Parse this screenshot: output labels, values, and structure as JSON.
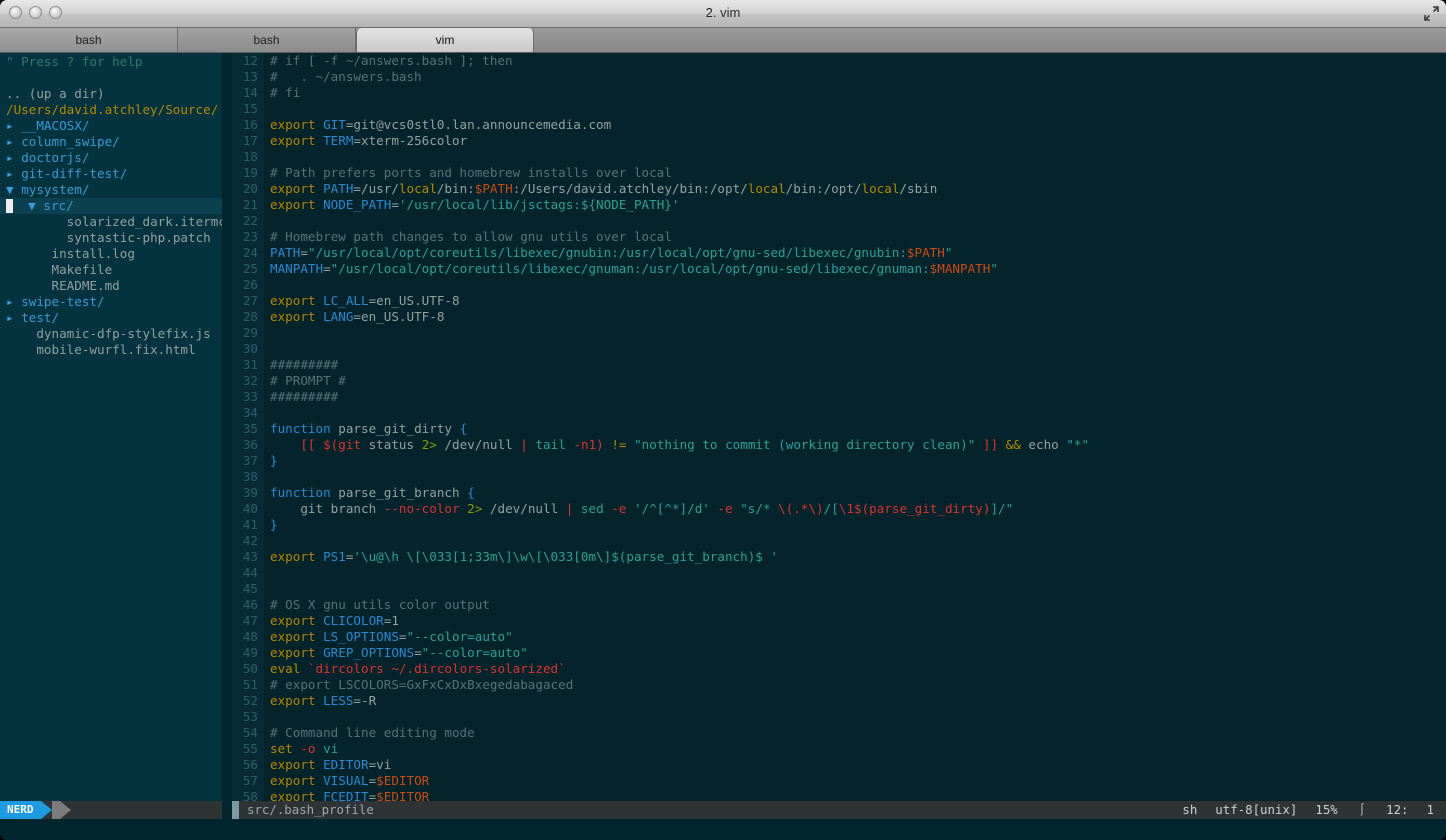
{
  "window": {
    "title": "2. vim",
    "traffic_lights": [
      "close",
      "minimize",
      "zoom"
    ],
    "fullscreen_icon": "fullscreen-icon"
  },
  "tabs": [
    {
      "label": "bash",
      "active": false
    },
    {
      "label": "bash",
      "active": false
    },
    {
      "label": "vim",
      "active": true
    }
  ],
  "nerdtree": {
    "help_line": "\" Press ? for help",
    "up_a_dir": ".. (up a dir)",
    "root": "/Users/david.atchley/Source/",
    "items": [
      {
        "label": "__MACOSX/",
        "type": "dir",
        "indent": 0,
        "open": false
      },
      {
        "label": "column_swipe/",
        "type": "dir",
        "indent": 0,
        "open": false
      },
      {
        "label": "doctorjs/",
        "type": "dir",
        "indent": 0,
        "open": false
      },
      {
        "label": "git-diff-test/",
        "type": "dir",
        "indent": 0,
        "open": false
      },
      {
        "label": "mysystem/",
        "type": "dir",
        "indent": 0,
        "open": true
      },
      {
        "label": "src/",
        "type": "dir",
        "indent": 1,
        "open": true,
        "selected": true
      },
      {
        "label": "solarized_dark.itermcolor",
        "type": "file",
        "indent": 2
      },
      {
        "label": "syntastic-php.patch",
        "type": "file",
        "indent": 2
      },
      {
        "label": "install.log",
        "type": "file",
        "indent": 1
      },
      {
        "label": "Makefile",
        "type": "file",
        "indent": 1
      },
      {
        "label": "README.md",
        "type": "file",
        "indent": 1
      },
      {
        "label": "swipe-test/",
        "type": "dir",
        "indent": 0,
        "open": false
      },
      {
        "label": "test/",
        "type": "dir",
        "indent": 0,
        "open": false
      },
      {
        "label": "dynamic-dfp-stylefix.js",
        "type": "file",
        "indent": 0
      },
      {
        "label": "mobile-wurfl.fix.html",
        "type": "file",
        "indent": 0
      }
    ]
  },
  "editor": {
    "first_line": 12,
    "lines": [
      {
        "n": 12,
        "tokens": [
          {
            "t": "# if [ -f ~/answers.bash ]; then",
            "c": "cmt"
          }
        ]
      },
      {
        "n": 13,
        "tokens": [
          {
            "t": "#   . ~/answers.bash",
            "c": "cmt"
          }
        ]
      },
      {
        "n": 14,
        "tokens": [
          {
            "t": "# fi",
            "c": "cmt"
          }
        ]
      },
      {
        "n": 15,
        "tokens": []
      },
      {
        "n": 16,
        "tokens": [
          {
            "t": "export ",
            "c": "kw"
          },
          {
            "t": "GIT",
            "c": "var"
          },
          {
            "t": "=git@vcs0stl0.lan.announcemedia.com",
            "c": "plain"
          }
        ]
      },
      {
        "n": 17,
        "tokens": [
          {
            "t": "export ",
            "c": "kw"
          },
          {
            "t": "TERM",
            "c": "var"
          },
          {
            "t": "=xterm-256color",
            "c": "plain"
          }
        ]
      },
      {
        "n": 18,
        "tokens": []
      },
      {
        "n": 19,
        "tokens": [
          {
            "t": "# Path prefers ports and homebrew installs over local",
            "c": "cmt"
          }
        ]
      },
      {
        "n": 20,
        "tokens": [
          {
            "t": "export ",
            "c": "kw"
          },
          {
            "t": "PATH",
            "c": "var"
          },
          {
            "t": "=/usr/",
            "c": "plain"
          },
          {
            "t": "local",
            "c": "hl"
          },
          {
            "t": "/bin:",
            "c": "plain"
          },
          {
            "t": "$PATH",
            "c": "dollar"
          },
          {
            "t": ":/Users/david.atchley/bin:/opt/",
            "c": "plain"
          },
          {
            "t": "local",
            "c": "hl"
          },
          {
            "t": "/bin:/opt/",
            "c": "plain"
          },
          {
            "t": "local",
            "c": "hl"
          },
          {
            "t": "/sbin",
            "c": "plain"
          }
        ]
      },
      {
        "n": 21,
        "tokens": [
          {
            "t": "export ",
            "c": "kw"
          },
          {
            "t": "NODE_PATH",
            "c": "var"
          },
          {
            "t": "=",
            "c": "plain"
          },
          {
            "t": "'/usr/local/lib/jsctags:${NODE_PATH}'",
            "c": "str"
          }
        ]
      },
      {
        "n": 22,
        "tokens": []
      },
      {
        "n": 23,
        "tokens": [
          {
            "t": "# Homebrew path changes to allow gnu utils over local",
            "c": "cmt"
          }
        ]
      },
      {
        "n": 24,
        "tokens": [
          {
            "t": "PATH",
            "c": "var"
          },
          {
            "t": "=",
            "c": "plain"
          },
          {
            "t": "\"/usr/local/opt/coreutils/libexec/gnubin:/usr/local/opt/gnu-sed/libexec/gnubin:",
            "c": "str"
          },
          {
            "t": "$PATH",
            "c": "dollar"
          },
          {
            "t": "\"",
            "c": "str"
          }
        ]
      },
      {
        "n": 25,
        "tokens": [
          {
            "t": "MANPATH",
            "c": "var"
          },
          {
            "t": "=",
            "c": "plain"
          },
          {
            "t": "\"/usr/local/opt/coreutils/libexec/gnuman:/usr/local/opt/gnu-sed/libexec/gnuman:",
            "c": "str"
          },
          {
            "t": "$MANPATH",
            "c": "dollar"
          },
          {
            "t": "\"",
            "c": "str"
          }
        ]
      },
      {
        "n": 26,
        "tokens": []
      },
      {
        "n": 27,
        "tokens": [
          {
            "t": "export ",
            "c": "kw"
          },
          {
            "t": "LC_ALL",
            "c": "var"
          },
          {
            "t": "=en_US.UTF-8",
            "c": "plain"
          }
        ]
      },
      {
        "n": 28,
        "tokens": [
          {
            "t": "export ",
            "c": "kw"
          },
          {
            "t": "LANG",
            "c": "var"
          },
          {
            "t": "=en_US.UTF-8",
            "c": "plain"
          }
        ]
      },
      {
        "n": 29,
        "tokens": []
      },
      {
        "n": 30,
        "tokens": []
      },
      {
        "n": 31,
        "tokens": [
          {
            "t": "#########",
            "c": "cmt"
          }
        ]
      },
      {
        "n": 32,
        "tokens": [
          {
            "t": "# PROMPT #",
            "c": "cmt"
          }
        ]
      },
      {
        "n": 33,
        "tokens": [
          {
            "t": "#########",
            "c": "cmt"
          }
        ]
      },
      {
        "n": 34,
        "tokens": []
      },
      {
        "n": 35,
        "tokens": [
          {
            "t": "function",
            "c": "var"
          },
          {
            "t": " parse_git_dirty ",
            "c": "plain"
          },
          {
            "t": "{",
            "c": "var"
          }
        ]
      },
      {
        "n": 36,
        "tokens": [
          {
            "t": "    ",
            "c": "plain"
          },
          {
            "t": "[[ ",
            "c": "red"
          },
          {
            "t": "$(",
            "c": "red"
          },
          {
            "t": "git",
            "c": "red"
          },
          {
            "t": " status ",
            "c": "plain"
          },
          {
            "t": "2>",
            "c": "grn"
          },
          {
            "t": " /dev/null ",
            "c": "plain"
          },
          {
            "t": "|",
            "c": "red"
          },
          {
            "t": " ",
            "c": "plain"
          },
          {
            "t": "tail",
            "c": "cy"
          },
          {
            "t": " ",
            "c": "plain"
          },
          {
            "t": "-n1",
            "c": "red"
          },
          {
            "t": ")",
            "c": "red"
          },
          {
            "t": " ",
            "c": "plain"
          },
          {
            "t": "!=",
            "c": "yel"
          },
          {
            "t": " ",
            "c": "plain"
          },
          {
            "t": "\"nothing to commit (working directory clean)\"",
            "c": "str"
          },
          {
            "t": " ",
            "c": "plain"
          },
          {
            "t": "]]",
            "c": "red"
          },
          {
            "t": " ",
            "c": "plain"
          },
          {
            "t": "&&",
            "c": "yel"
          },
          {
            "t": " echo ",
            "c": "plain"
          },
          {
            "t": "\"*\"",
            "c": "str"
          }
        ]
      },
      {
        "n": 37,
        "tokens": [
          {
            "t": "}",
            "c": "var"
          }
        ]
      },
      {
        "n": 38,
        "tokens": []
      },
      {
        "n": 39,
        "tokens": [
          {
            "t": "function",
            "c": "var"
          },
          {
            "t": " parse_git_branch ",
            "c": "plain"
          },
          {
            "t": "{",
            "c": "var"
          }
        ]
      },
      {
        "n": 40,
        "tokens": [
          {
            "t": "    git branch ",
            "c": "plain"
          },
          {
            "t": "--no-color",
            "c": "red"
          },
          {
            "t": " ",
            "c": "plain"
          },
          {
            "t": "2>",
            "c": "grn"
          },
          {
            "t": " /dev/null ",
            "c": "plain"
          },
          {
            "t": "|",
            "c": "red"
          },
          {
            "t": " ",
            "c": "plain"
          },
          {
            "t": "sed",
            "c": "cy"
          },
          {
            "t": " ",
            "c": "plain"
          },
          {
            "t": "-e",
            "c": "red"
          },
          {
            "t": " ",
            "c": "plain"
          },
          {
            "t": "'/^[^*]/d'",
            "c": "str"
          },
          {
            "t": " ",
            "c": "plain"
          },
          {
            "t": "-e",
            "c": "red"
          },
          {
            "t": " ",
            "c": "plain"
          },
          {
            "t": "\"s/* ",
            "c": "str"
          },
          {
            "t": "\\(.*\\)",
            "c": "red"
          },
          {
            "t": "/[",
            "c": "str"
          },
          {
            "t": "\\1",
            "c": "red"
          },
          {
            "t": "$(parse_git_dirty)",
            "c": "red"
          },
          {
            "t": "]/\"",
            "c": "str"
          }
        ]
      },
      {
        "n": 41,
        "tokens": [
          {
            "t": "}",
            "c": "var"
          }
        ]
      },
      {
        "n": 42,
        "tokens": []
      },
      {
        "n": 43,
        "tokens": [
          {
            "t": "export ",
            "c": "kw"
          },
          {
            "t": "PS1",
            "c": "var"
          },
          {
            "t": "=",
            "c": "plain"
          },
          {
            "t": "'\\u@\\h \\[\\033[1;33m\\]\\w\\[\\033[0m\\]$(parse_git_branch)$ '",
            "c": "str"
          }
        ]
      },
      {
        "n": 44,
        "tokens": []
      },
      {
        "n": 45,
        "tokens": []
      },
      {
        "n": 46,
        "tokens": [
          {
            "t": "# OS X gnu utils color output",
            "c": "cmt"
          }
        ]
      },
      {
        "n": 47,
        "tokens": [
          {
            "t": "export ",
            "c": "kw"
          },
          {
            "t": "CLICOLOR",
            "c": "var"
          },
          {
            "t": "=1",
            "c": "plain"
          }
        ]
      },
      {
        "n": 48,
        "tokens": [
          {
            "t": "export ",
            "c": "kw"
          },
          {
            "t": "LS_OPTIONS",
            "c": "var"
          },
          {
            "t": "=",
            "c": "plain"
          },
          {
            "t": "\"--color=auto\"",
            "c": "str"
          }
        ]
      },
      {
        "n": 49,
        "tokens": [
          {
            "t": "export ",
            "c": "kw"
          },
          {
            "t": "GREP_OPTIONS",
            "c": "var"
          },
          {
            "t": "=",
            "c": "plain"
          },
          {
            "t": "\"--color=auto\"",
            "c": "str"
          }
        ]
      },
      {
        "n": 50,
        "tokens": [
          {
            "t": "eval ",
            "c": "kw"
          },
          {
            "t": "`dircolors ~/.dircolors-solarized`",
            "c": "red"
          }
        ]
      },
      {
        "n": 51,
        "tokens": [
          {
            "t": "# export LSCOLORS=GxFxCxDxBxegedabagaced",
            "c": "cmt"
          }
        ]
      },
      {
        "n": 52,
        "tokens": [
          {
            "t": "export ",
            "c": "kw"
          },
          {
            "t": "LESS",
            "c": "var"
          },
          {
            "t": "=-R",
            "c": "plain"
          }
        ]
      },
      {
        "n": 53,
        "tokens": []
      },
      {
        "n": 54,
        "tokens": [
          {
            "t": "# Command line editing mode",
            "c": "cmt"
          }
        ]
      },
      {
        "n": 55,
        "tokens": [
          {
            "t": "set ",
            "c": "kw"
          },
          {
            "t": "-o",
            "c": "red"
          },
          {
            "t": " ",
            "c": "plain"
          },
          {
            "t": "vi",
            "c": "cy"
          }
        ]
      },
      {
        "n": 56,
        "tokens": [
          {
            "t": "export ",
            "c": "kw"
          },
          {
            "t": "EDITOR",
            "c": "var"
          },
          {
            "t": "=vi",
            "c": "plain"
          }
        ]
      },
      {
        "n": 57,
        "tokens": [
          {
            "t": "export ",
            "c": "kw"
          },
          {
            "t": "VISUAL",
            "c": "var"
          },
          {
            "t": "=",
            "c": "plain"
          },
          {
            "t": "$EDITOR",
            "c": "dollar"
          }
        ]
      },
      {
        "n": 58,
        "tokens": [
          {
            "t": "export ",
            "c": "kw"
          },
          {
            "t": "FCEDIT",
            "c": "var"
          },
          {
            "t": "=",
            "c": "plain"
          },
          {
            "t": "$EDITOR",
            "c": "dollar"
          }
        ]
      }
    ]
  },
  "statusline": {
    "nerd_badge": "NERD",
    "filename": "src/.bash_profile",
    "filetype": "sh",
    "encoding": "utf-8[unix]",
    "percent": "15%",
    "position_icon": "line-number-icon",
    "line": "12:",
    "col": "1"
  },
  "colors": {
    "accent_blue": "#1e9ae0",
    "background": "#03252e",
    "nerdtree_bg": "#04323e",
    "status_bg": "#2e3436",
    "keyword": "#b58900",
    "variable": "#268bd2",
    "string": "#2aa198",
    "comment": "#56727a",
    "error_red": "#dc322f",
    "orange": "#cb4b16"
  }
}
